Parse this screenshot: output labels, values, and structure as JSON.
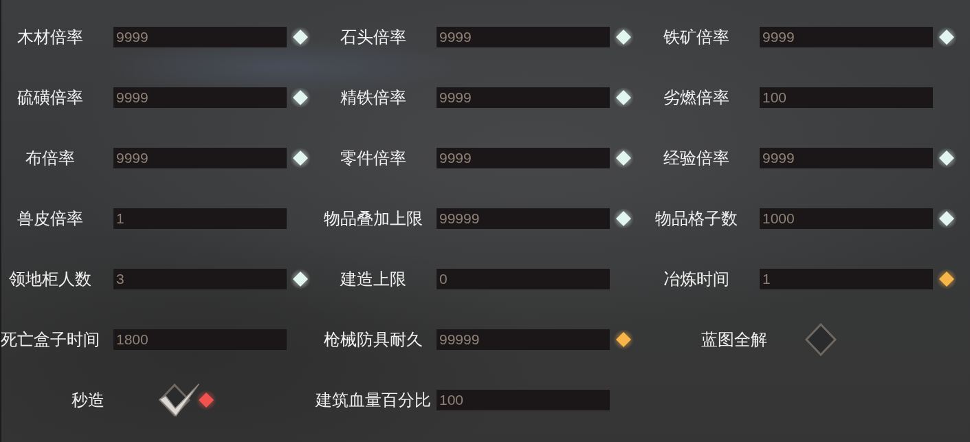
{
  "settings": [
    {
      "kind": "field",
      "label": "木材倍率",
      "value": "9999",
      "color": "#e2f6ef"
    },
    {
      "kind": "field",
      "label": "石头倍率",
      "value": "9999",
      "color": "#e2f6ef"
    },
    {
      "kind": "field",
      "label": "铁矿倍率",
      "value": "9999",
      "color": "#e2f6ef"
    },
    {
      "kind": "field",
      "label": "硫磺倍率",
      "value": "9999",
      "color": "#e2f6ef"
    },
    {
      "kind": "field",
      "label": "精铁倍率",
      "value": "9999",
      "color": "#e2f6ef"
    },
    {
      "kind": "field",
      "label": "劣燃倍率",
      "value": "100"
    },
    {
      "kind": "field",
      "label": "布倍率",
      "value": "9999",
      "color": "#e2f6ef"
    },
    {
      "kind": "field",
      "label": "零件倍率",
      "value": "9999",
      "color": "#e2f6ef"
    },
    {
      "kind": "field",
      "label": "经验倍率",
      "value": "9999",
      "color": "#e2f6ef"
    },
    {
      "kind": "field",
      "label": "兽皮倍率",
      "value": "1"
    },
    {
      "kind": "field",
      "label": "物品叠加上限",
      "value": "99999",
      "color": "#e2f6ef"
    },
    {
      "kind": "field",
      "label": "物品格子数",
      "value": "1000",
      "color": "#e2f6ef"
    },
    {
      "kind": "field",
      "label": "领地柜人数",
      "value": "3",
      "color": "#e2f6ef"
    },
    {
      "kind": "field",
      "label": "建造上限",
      "value": "0"
    },
    {
      "kind": "field",
      "label": "冶炼时间",
      "value": "1",
      "color": "#f8b548"
    },
    {
      "kind": "field",
      "label": "死亡盒子时间",
      "value": "1800"
    },
    {
      "kind": "field",
      "label": "枪械防具耐久",
      "value": "99999",
      "color": "#f8b548"
    },
    {
      "kind": "checkbox",
      "label": "蓝图全解",
      "checked": false
    },
    {
      "kind": "checkbox",
      "label": "秒造",
      "checked": true,
      "color": "#f0524e"
    },
    {
      "kind": "field",
      "label": "建筑血量百分比",
      "value": "100"
    }
  ]
}
